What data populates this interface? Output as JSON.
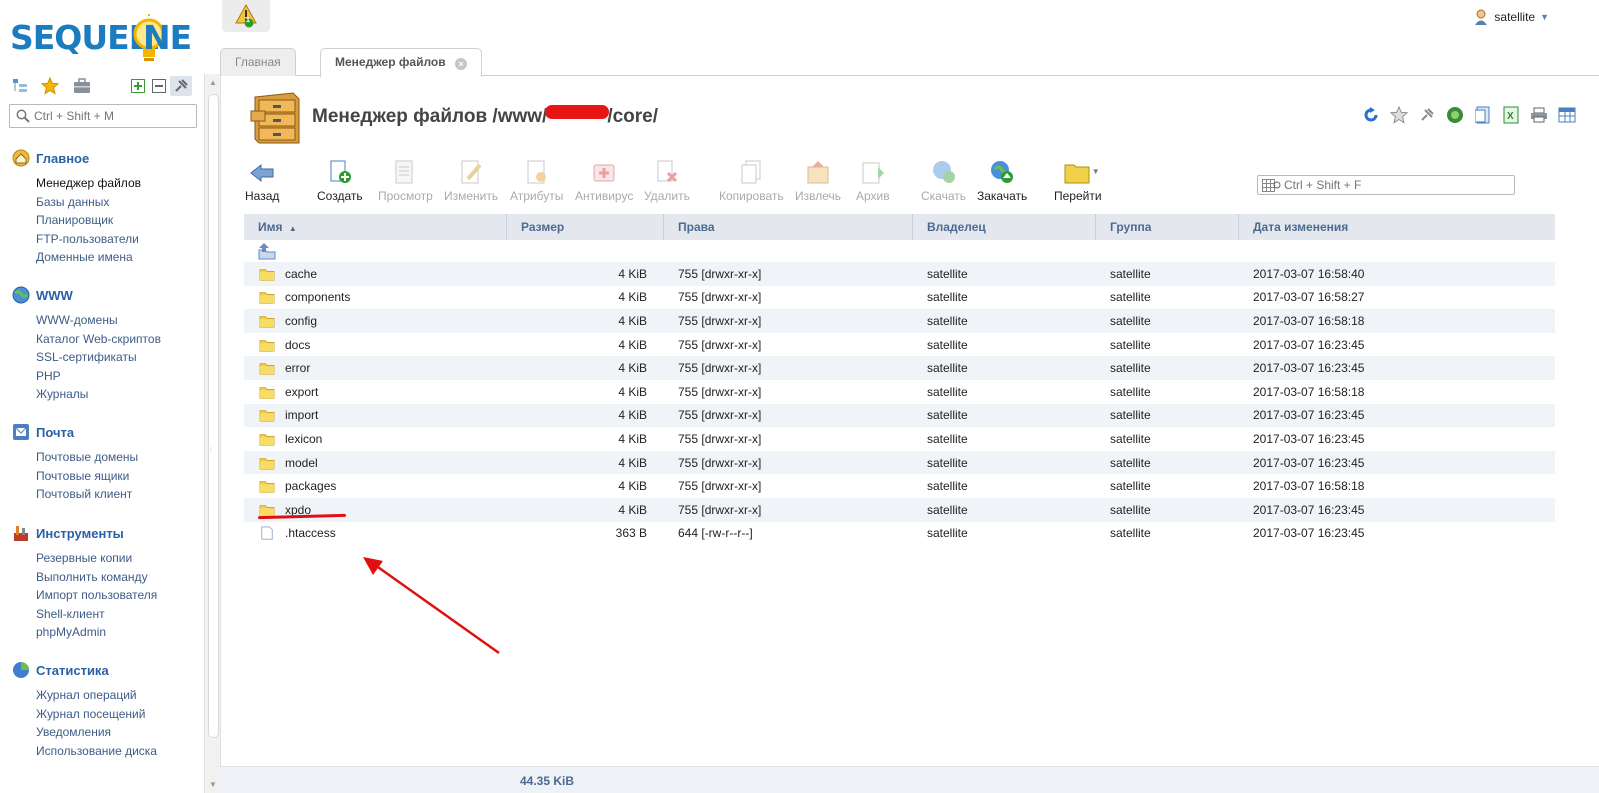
{
  "app": {
    "logo_left": "SEQUEL.",
    "logo_right": "NE"
  },
  "alerts": {
    "count": "1"
  },
  "user": {
    "name": "satellite"
  },
  "sidebar": {
    "search_placeholder": "Ctrl + Shift + M",
    "groups": [
      {
        "title": "Главное",
        "items": [
          "Менеджер файлов",
          "Базы данных",
          "Планировщик",
          "FTP-пользователи",
          "Доменные имена"
        ]
      },
      {
        "title": "WWW",
        "items": [
          "WWW-домены",
          "Каталог Web-скриптов",
          "SSL-сертификаты",
          "PHP",
          "Журналы"
        ]
      },
      {
        "title": "Почта",
        "items": [
          "Почтовые домены",
          "Почтовые ящики",
          "Почтовый клиент"
        ]
      },
      {
        "title": "Инструменты",
        "items": [
          "Резервные копии",
          "Выполнить команду",
          "Импорт пользователя",
          "Shell-клиент",
          "phpMyAdmin"
        ]
      },
      {
        "title": "Статистика",
        "items": [
          "Журнал операций",
          "Журнал посещений",
          "Уведомления",
          "Использование диска"
        ]
      }
    ]
  },
  "tabs": [
    {
      "label": "Главная"
    },
    {
      "label": "Менеджер файлов"
    }
  ],
  "page": {
    "title_prefix": "Менеджер файлов /www/",
    "title_suffix": "/core/"
  },
  "toolbar": {
    "back": "Назад",
    "create": "Создать",
    "view": "Просмотр",
    "edit": "Изменить",
    "attributes": "Атрибуты",
    "antivirus": "Антивирус",
    "delete": "Удалить",
    "copy": "Копировать",
    "extract": "Извлечь",
    "archive": "Архив",
    "download": "Скачать",
    "upload": "Закачать",
    "goto": "Перейти",
    "search_placeholder": "Ctrl + Shift + F"
  },
  "table": {
    "columns": [
      "Имя",
      "Размер",
      "Права",
      "Владелец",
      "Группа",
      "Дата изменения"
    ],
    "rows": [
      {
        "name": "cache",
        "size": "4 KiB",
        "perm": "755 [drwxr-xr-x]",
        "owner": "satellite",
        "group": "satellite",
        "date": "2017-03-07 16:58:40",
        "type": "folder"
      },
      {
        "name": "components",
        "size": "4 KiB",
        "perm": "755 [drwxr-xr-x]",
        "owner": "satellite",
        "group": "satellite",
        "date": "2017-03-07 16:58:27",
        "type": "folder"
      },
      {
        "name": "config",
        "size": "4 KiB",
        "perm": "755 [drwxr-xr-x]",
        "owner": "satellite",
        "group": "satellite",
        "date": "2017-03-07 16:58:18",
        "type": "folder"
      },
      {
        "name": "docs",
        "size": "4 KiB",
        "perm": "755 [drwxr-xr-x]",
        "owner": "satellite",
        "group": "satellite",
        "date": "2017-03-07 16:23:45",
        "type": "folder"
      },
      {
        "name": "error",
        "size": "4 KiB",
        "perm": "755 [drwxr-xr-x]",
        "owner": "satellite",
        "group": "satellite",
        "date": "2017-03-07 16:23:45",
        "type": "folder"
      },
      {
        "name": "export",
        "size": "4 KiB",
        "perm": "755 [drwxr-xr-x]",
        "owner": "satellite",
        "group": "satellite",
        "date": "2017-03-07 16:58:18",
        "type": "folder"
      },
      {
        "name": "import",
        "size": "4 KiB",
        "perm": "755 [drwxr-xr-x]",
        "owner": "satellite",
        "group": "satellite",
        "date": "2017-03-07 16:23:45",
        "type": "folder"
      },
      {
        "name": "lexicon",
        "size": "4 KiB",
        "perm": "755 [drwxr-xr-x]",
        "owner": "satellite",
        "group": "satellite",
        "date": "2017-03-07 16:23:45",
        "type": "folder"
      },
      {
        "name": "model",
        "size": "4 KiB",
        "perm": "755 [drwxr-xr-x]",
        "owner": "satellite",
        "group": "satellite",
        "date": "2017-03-07 16:23:45",
        "type": "folder"
      },
      {
        "name": "packages",
        "size": "4 KiB",
        "perm": "755 [drwxr-xr-x]",
        "owner": "satellite",
        "group": "satellite",
        "date": "2017-03-07 16:58:18",
        "type": "folder"
      },
      {
        "name": "xpdo",
        "size": "4 KiB",
        "perm": "755 [drwxr-xr-x]",
        "owner": "satellite",
        "group": "satellite",
        "date": "2017-03-07 16:23:45",
        "type": "folder"
      },
      {
        "name": ".htaccess",
        "size": "363 B",
        "perm": "644 [-rw-r--r--]",
        "owner": "satellite",
        "group": "satellite",
        "date": "2017-03-07 16:23:45",
        "type": "file"
      }
    ]
  },
  "footer": {
    "total": "44.35 KiB"
  },
  "colors": {
    "accent": "#2a61a6",
    "logo": "#1c7cc0",
    "annotation": "#e01010",
    "header_bg": "#e4e8ee",
    "row_alt": "#f0f3f7"
  }
}
